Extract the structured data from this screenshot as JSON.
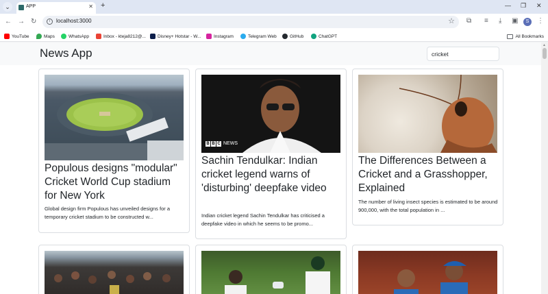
{
  "browser": {
    "tab_title": "APP",
    "url": "localhost:3000",
    "profile_initial": "S",
    "bookmarks": [
      {
        "label": "YouTube",
        "color": "#ff0000"
      },
      {
        "label": "Maps",
        "color": "#34a853"
      },
      {
        "label": "WhatsApp",
        "color": "#25d366"
      },
      {
        "label": "Inbox - kteja8212@...",
        "color": "#ea4335"
      },
      {
        "label": "Disney+ Hotstar - W...",
        "color": "#0c1e4a"
      },
      {
        "label": "Instagram",
        "color": "#d6249f"
      },
      {
        "label": "Telegram Web",
        "color": "#2aabee"
      },
      {
        "label": "GitHub",
        "color": "#24292f"
      },
      {
        "label": "ChatGPT",
        "color": "#10a37f"
      }
    ],
    "all_bookmarks": "All Bookmarks"
  },
  "app": {
    "title": "News App",
    "search_value": "cricket"
  },
  "articles": [
    {
      "title": "Populous designs \"modular\" Cricket World Cup stadium for New York",
      "description": "Global design firm Populous has unveiled designs for a temporary cricket stadium to be constructed w..."
    },
    {
      "title": "Sachin Tendulkar: Indian cricket legend warns of 'disturbing' deepfake video",
      "description": "Indian cricket legend Sachin Tendulkar has criticised a deepfake video in which he seems to be promo...",
      "image_badge": "NEWS"
    },
    {
      "title": "The Differences Between a Cricket and a Grasshopper, Explained",
      "description": "The number of living insect species is estimated to be around 900,000, with the total population in ..."
    },
    {
      "title": "",
      "description": ""
    },
    {
      "title": "",
      "description": ""
    },
    {
      "title": "",
      "description": ""
    }
  ]
}
